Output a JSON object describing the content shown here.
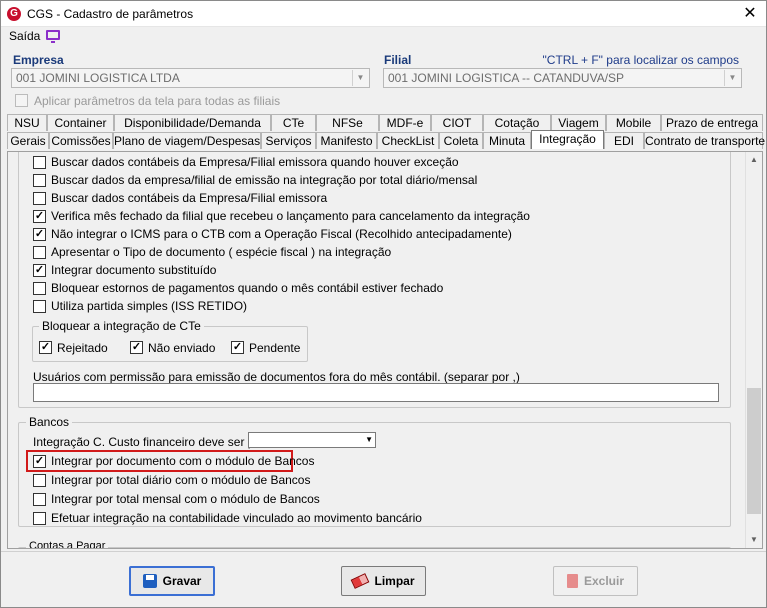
{
  "window": {
    "title": "CGS - Cadastro de parâmetros",
    "close": "✕",
    "logo": "G"
  },
  "menu": {
    "saida": "Saída"
  },
  "empresa": {
    "label": "Empresa",
    "value": "001 JOMINI LOGISTICA LTDA"
  },
  "filial": {
    "label": "Filial",
    "value": "001 JOMINI LOGISTICA -- CATANDUVA/SP"
  },
  "hint": "\"CTRL + F\" para localizar os campos",
  "apply_all": "Aplicar parâmetros da tela para todas as filiais",
  "tabs_row1": [
    "NSU",
    "Container",
    "Disponibilidade/Demanda",
    "CTe",
    "NFSe",
    "MDF-e",
    "CIOT",
    "Cotação",
    "Viagem",
    "Mobile",
    "Prazo de entrega"
  ],
  "tabs_row2": [
    "Gerais",
    "Comissões",
    "Plano de viagem/Despesas",
    "Serviços",
    "Manifesto",
    "CheckList",
    "Coleta",
    "Minuta",
    "Integração",
    "EDI",
    "Contrato de transporte"
  ],
  "options": [
    {
      "label": "Buscar dados contábeis da Empresa/Filial emissora quando houver exceção",
      "checked": false
    },
    {
      "label": "Buscar dados da empresa/filial de emissão na integração por total diário/mensal",
      "checked": false
    },
    {
      "label": "Buscar dados contábeis da Empresa/Filial emissora",
      "checked": false
    },
    {
      "label": "Verifica mês fechado da filial que recebeu o lançamento para cancelamento da integração",
      "checked": true
    },
    {
      "label": "Não integrar o ICMS para o CTB com a Operação Fiscal (Recolhido antecipadamente)",
      "checked": true
    },
    {
      "label": "Apresentar o Tipo de documento ( espécie fiscal ) na integração",
      "checked": false
    },
    {
      "label": "Integrar documento substituído",
      "checked": true
    },
    {
      "label": "Bloquear estornos de pagamentos quando o mês contábil estiver fechado",
      "checked": false
    },
    {
      "label": "Utiliza partida simples (ISS RETIDO)",
      "checked": false
    }
  ],
  "bloquear_cte": {
    "title": "Bloquear a integração de CTe",
    "items": [
      {
        "label": "Rejeitado",
        "checked": true
      },
      {
        "label": "Não enviado",
        "checked": true
      },
      {
        "label": "Pendente",
        "checked": true
      }
    ]
  },
  "usuarios_label": "Usuários com permissão para emissão de documentos fora do mês contábil. (separar por ,)",
  "bancos": {
    "title": "Bancos",
    "custo_label": "Integração C. Custo financeiro deve ser por",
    "items": [
      {
        "label": "Integrar por documento com o módulo de Bancos",
        "checked": true
      },
      {
        "label": "Integrar por total diário com o módulo de Bancos",
        "checked": false
      },
      {
        "label": "Integrar por total mensal com o módulo de Bancos",
        "checked": false
      },
      {
        "label": "Efetuar integração na contabilidade vinculado ao movimento bancário",
        "checked": false
      }
    ]
  },
  "next_group": "Contas a Pagar",
  "buttons": {
    "gravar": "Gravar",
    "limpar": "Limpar",
    "excluir": "Excluir"
  },
  "colors": {
    "highlight": "#d11a1a",
    "label_blue": "#1a3a7a"
  }
}
